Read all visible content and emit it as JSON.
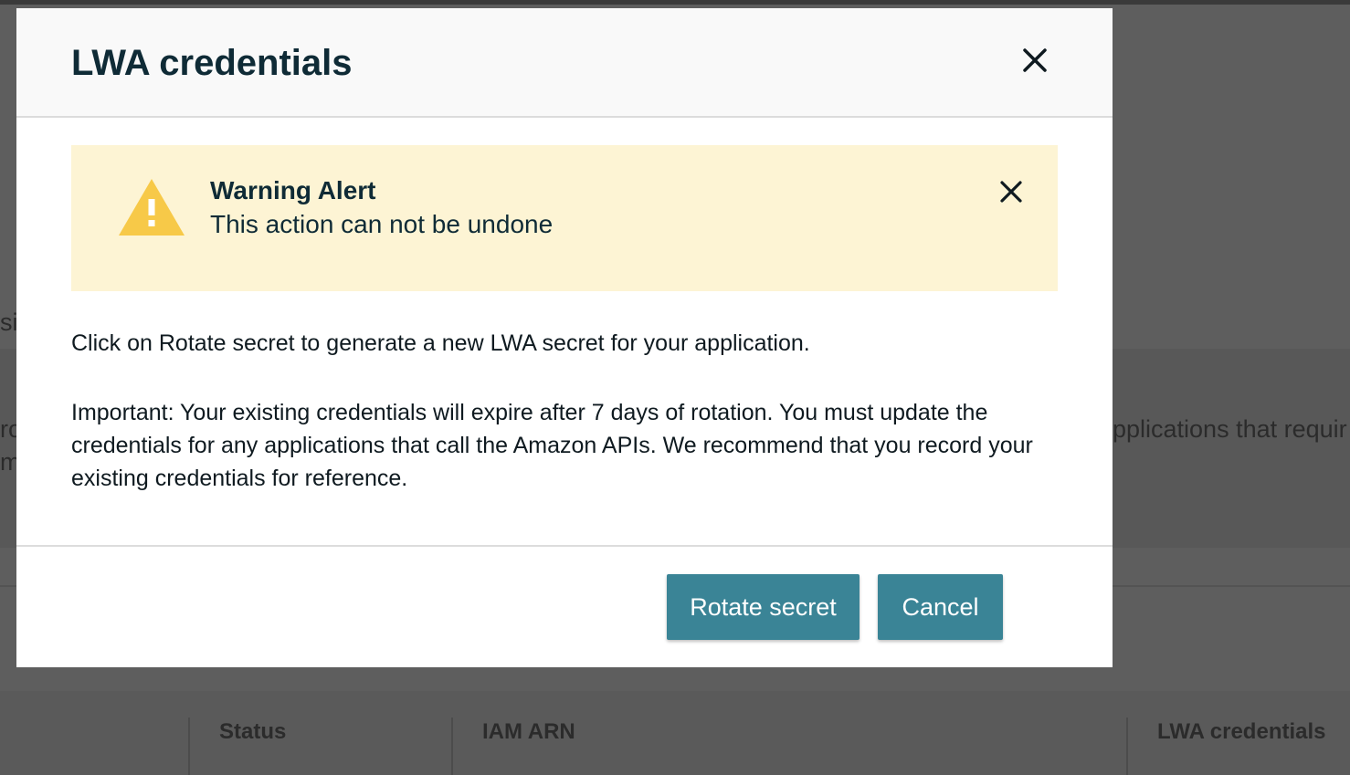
{
  "modal": {
    "title": "LWA credentials",
    "close_icon": "close-icon",
    "alert": {
      "title": "Warning Alert",
      "message": "This action can not be undone",
      "icon": "warning-triangle-icon",
      "icon_color": "#f7c948",
      "background_color": "#fdf4d4",
      "close_icon": "close-icon"
    },
    "paragraphs": [
      "Click on Rotate secret to generate a new LWA secret for your application.",
      "Important: Your existing credentials will expire after 7 days of rotation. You must update the credentials for any applications that call the Amazon APIs. We recommend that you record your existing credentials for reference."
    ],
    "buttons": {
      "rotate_label": "Rotate secret",
      "cancel_label": "Cancel",
      "button_color": "#3a8496"
    }
  },
  "background_page": {
    "text_fragments": [
      "si",
      "ro",
      "m",
      "pplications that requir"
    ],
    "table_headers": [
      "Status",
      "IAM ARN",
      "LWA credentials"
    ]
  }
}
